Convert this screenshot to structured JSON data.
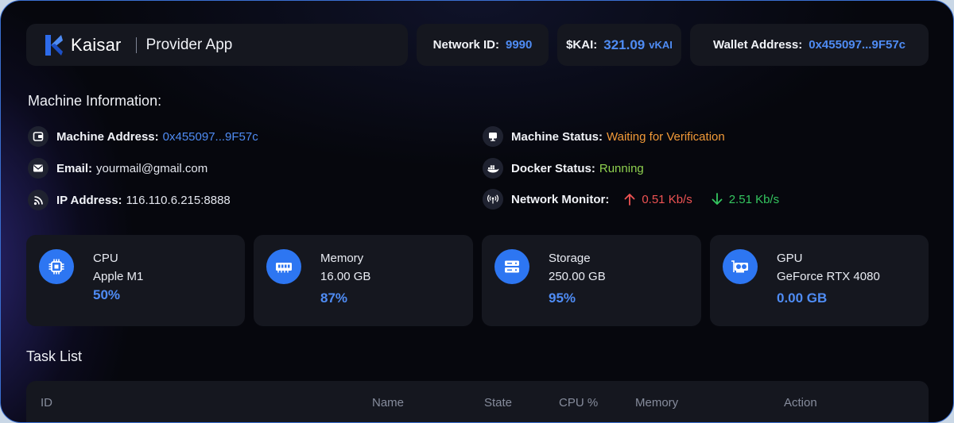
{
  "header": {
    "brand_name": "Kaisar",
    "app_name": "Provider App",
    "network_id_label": "Network ID:",
    "network_id_value": "9990",
    "kai_label": "$KAI:",
    "kai_value": "321.09",
    "kai_unit": "vKAI",
    "wallet_label": "Wallet Address:",
    "wallet_value": "0x455097...9F57c"
  },
  "machine_info": {
    "title": "Machine Information:",
    "address_label": "Machine Address:",
    "address_value": "0x455097...9F57c",
    "email_label": "Email:",
    "email_value": "yourmail@gmail.com",
    "ip_label": "IP Address:",
    "ip_value": "116.110.6.215:8888",
    "status_label": "Machine Status:",
    "status_value": "Waiting for Verification",
    "docker_label": "Docker Status:",
    "docker_value": "Running",
    "network_label": "Network Monitor:",
    "upload_value": "0.51 Kb/s",
    "download_value": "2.51 Kb/s"
  },
  "resources": [
    {
      "name": "CPU",
      "spec": "Apple M1",
      "value": "50%",
      "icon": "cpu-icon"
    },
    {
      "name": "Memory",
      "spec": "16.00 GB",
      "value": "87%",
      "icon": "memory-icon"
    },
    {
      "name": "Storage",
      "spec": "250.00 GB",
      "value": "95%",
      "icon": "storage-icon"
    },
    {
      "name": "GPU",
      "spec": "GeForce RTX 4080",
      "value": "0.00 GB",
      "icon": "gpu-icon"
    }
  ],
  "task_list": {
    "title": "Task List",
    "columns": [
      "ID",
      "Name",
      "State",
      "CPU %",
      "Memory",
      "Action"
    ]
  },
  "colors": {
    "accent": "#4f8cf4",
    "status_waiting": "#f29a38",
    "status_running": "#8fd14f",
    "upload": "#ef5353",
    "download": "#34c55f"
  }
}
